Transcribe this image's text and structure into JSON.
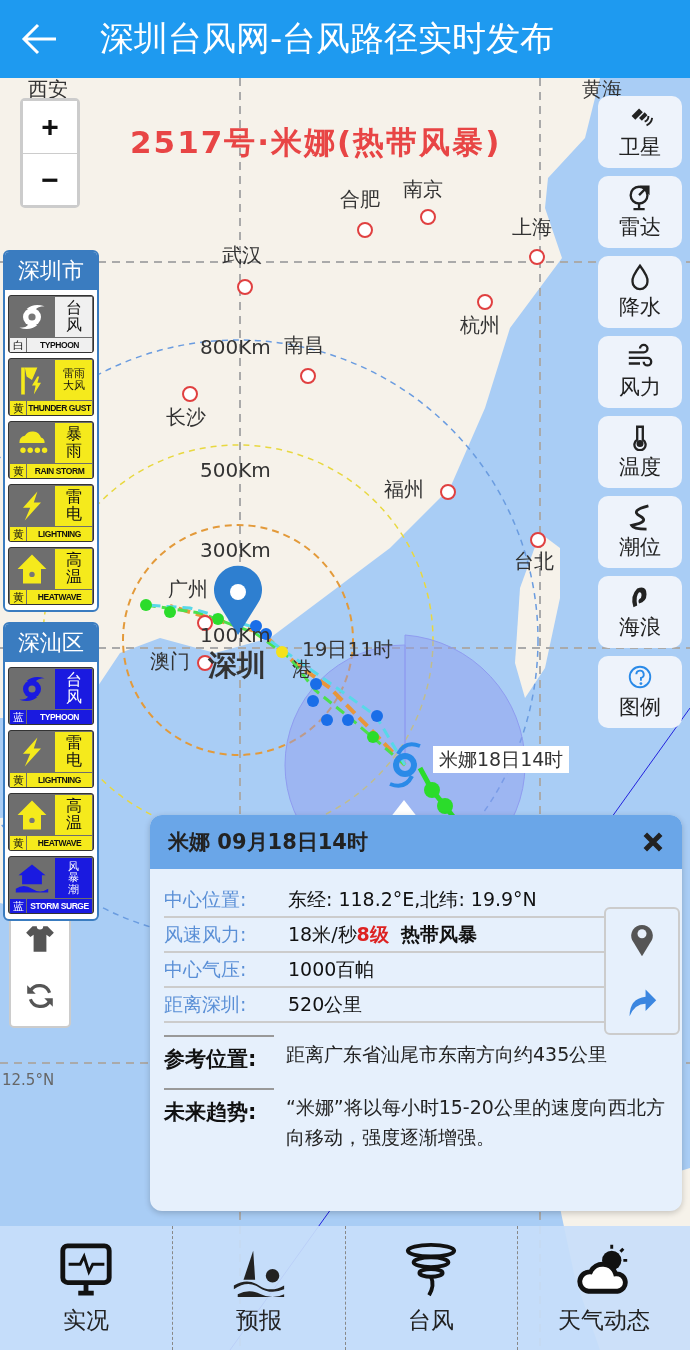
{
  "header": {
    "title": "深圳台风网-台风路径实时发布"
  },
  "typhoon_title": "2517号·米娜(热带风暴)",
  "zoom_controls": [
    "+",
    "−"
  ],
  "map": {
    "place_labels": [
      "西安",
      "黄海",
      "合肥",
      "南京",
      "上海",
      "武汉",
      "杭州",
      "南昌",
      "长沙",
      "福州",
      "台北",
      "广州",
      "澳门",
      "港"
    ],
    "center_city": "深圳",
    "range_labels": [
      "800Km",
      "500Km",
      "300Km",
      "100Km"
    ],
    "track_labels": [
      "19日11时",
      "米娜18日14时"
    ],
    "grid_labels": [
      "12.5°N"
    ]
  },
  "warnings": [
    {
      "region": "深圳市",
      "signals": [
        {
          "kind": "typhoon",
          "name": "台风",
          "level": "白",
          "english": "TYPHOON",
          "color": "#f0f0f0"
        },
        {
          "kind": "thunder_gust",
          "name": "雷雨大风",
          "level": "黄",
          "english": "THUNDER GUST",
          "color": "#f5ea1c"
        },
        {
          "kind": "rainstorm",
          "name": "暴雨",
          "level": "黄",
          "english": "RAIN STORM",
          "color": "#f5ea1c"
        },
        {
          "kind": "lightning",
          "name": "雷电",
          "level": "黄",
          "english": "LIGHTNING",
          "color": "#f5ea1c"
        },
        {
          "kind": "heatwave",
          "name": "高温",
          "level": "黄",
          "english": "HEATWAVE",
          "color": "#f5ea1c"
        }
      ]
    },
    {
      "region": "深汕区",
      "signals": [
        {
          "kind": "typhoon",
          "name": "台风",
          "level": "蓝",
          "english": "TYPHOON",
          "color": "#1a1ae0"
        },
        {
          "kind": "lightning",
          "name": "雷电",
          "level": "黄",
          "english": "LIGHTNING",
          "color": "#f5ea1c"
        },
        {
          "kind": "heatwave",
          "name": "高温",
          "level": "黄",
          "english": "HEATWAVE",
          "color": "#f5ea1c"
        },
        {
          "kind": "storm_surge",
          "name": "风暴潮",
          "level": "蓝",
          "english": "STORM SURGE",
          "color": "#1a1ae0"
        }
      ]
    }
  ],
  "side_buttons": [
    {
      "kind": "satellite",
      "label": "卫星"
    },
    {
      "kind": "radar",
      "label": "雷达"
    },
    {
      "kind": "rain",
      "label": "降水"
    },
    {
      "kind": "wind",
      "label": "风力"
    },
    {
      "kind": "temperature",
      "label": "温度"
    },
    {
      "kind": "tide",
      "label": "潮位"
    },
    {
      "kind": "wave",
      "label": "海浪"
    },
    {
      "kind": "legend",
      "label": "图例"
    }
  ],
  "popup": {
    "title": "米娜 09月18日14时",
    "info_rows": [
      {
        "label": "中心位置:",
        "value": "东经: 118.2°E,北纬: 19.9°N"
      },
      {
        "label": "风速风力:",
        "value": "18米/秒",
        "grade": "8级",
        "category": "热带风暴"
      },
      {
        "label": "中心气压:",
        "value": "1000百帕"
      },
      {
        "label": "距离深圳:",
        "value": "520公里"
      }
    ],
    "notes": [
      {
        "label": "参考位置:",
        "text": "距离广东省汕尾市东南方向约435公里"
      },
      {
        "label": "未来趋势:",
        "text": "“米娜”将以每小时15-20公里的速度向西北方向移动，强度逐渐增强。"
      }
    ]
  },
  "bottom_nav": [
    {
      "kind": "observation",
      "label": "实况"
    },
    {
      "kind": "forecast",
      "label": "预报"
    },
    {
      "kind": "typhoon",
      "label": "台风"
    },
    {
      "kind": "weather",
      "label": "天气动态"
    }
  ]
}
